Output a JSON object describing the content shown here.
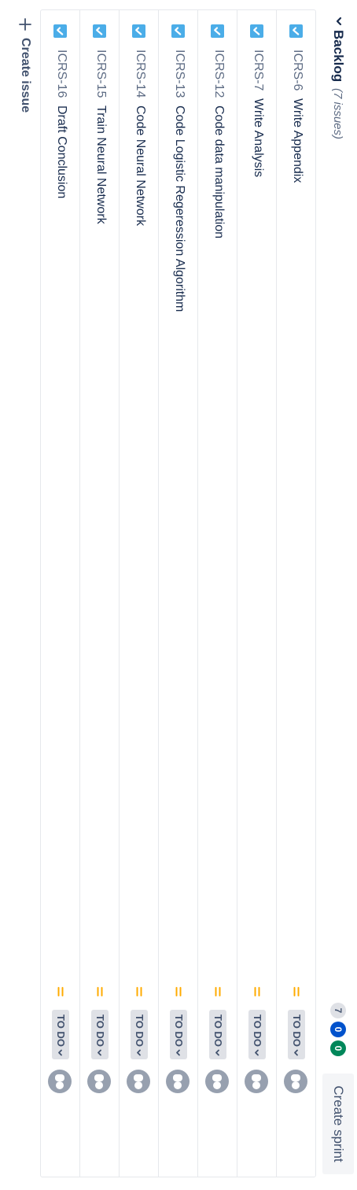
{
  "backlog": {
    "title": "Backlog",
    "issue_count": "(7 issues)",
    "counters": {
      "todo": "7",
      "in_progress": "0",
      "done": "0"
    },
    "create_sprint_label": "Create sprint"
  },
  "issues": [
    {
      "key": "ICRS-6",
      "summary": "Write Appendix",
      "status": "TO DO",
      "type_icon": "task-checkbox-icon",
      "priority_icon": "medium-priority-icon"
    },
    {
      "key": "ICRS-7",
      "summary": "Write Analysis",
      "status": "TO DO",
      "type_icon": "task-checkbox-icon",
      "priority_icon": "medium-priority-icon"
    },
    {
      "key": "ICRS-12",
      "summary": "Code data manipulation",
      "status": "TO DO",
      "type_icon": "task-checkbox-icon",
      "priority_icon": "medium-priority-icon"
    },
    {
      "key": "ICRS-13",
      "summary": "Code Logistic Regeression Algorithm",
      "status": "TO DO",
      "type_icon": "task-checkbox-icon",
      "priority_icon": "medium-priority-icon"
    },
    {
      "key": "ICRS-14",
      "summary": "Code Neural Network",
      "status": "TO DO",
      "type_icon": "task-checkbox-icon",
      "priority_icon": "medium-priority-icon"
    },
    {
      "key": "ICRS-15",
      "summary": "Train Neural Network",
      "status": "TO DO",
      "type_icon": "task-checkbox-icon",
      "priority_icon": "medium-priority-icon"
    },
    {
      "key": "ICRS-16",
      "summary": "Draft Conclusion",
      "status": "TO DO",
      "type_icon": "task-checkbox-icon",
      "priority_icon": "medium-priority-icon"
    }
  ],
  "footer": {
    "create_issue_label": "Create issue"
  },
  "colors": {
    "task_icon": "#4bade8",
    "priority_medium": "#ffab00",
    "status_bg": "#dfe1e6",
    "in_progress_pill": "#0052cc",
    "done_pill": "#00875a",
    "text_primary": "#172b4d",
    "text_secondary": "#5e6c84"
  }
}
